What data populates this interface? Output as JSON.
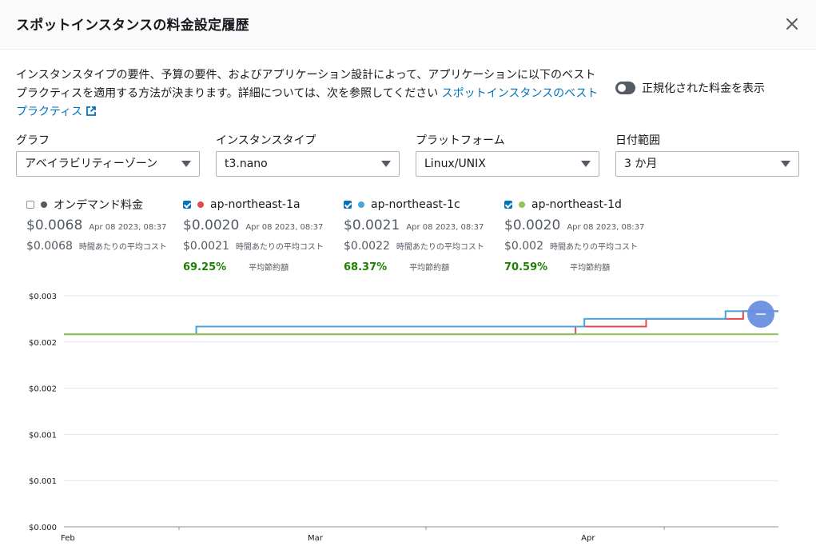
{
  "modal": {
    "title": "スポットインスタンスの料金設定履歴",
    "description": "インスタンスタイプの要件、予算の要件、およびアプリケーション設計によって、アプリケーションに以下のベストプラクティスを適用する方法が決まります。詳細については、次を参照してください",
    "link_text": "スポットインスタンスのベストプラクティス",
    "toggle_label": "正規化された料金を表示"
  },
  "filters": {
    "graph": {
      "label": "グラフ",
      "value": "アベイラビリティーゾーン"
    },
    "instance_type": {
      "label": "インスタンスタイプ",
      "value": "t3.nano"
    },
    "platform": {
      "label": "プラットフォーム",
      "value": "Linux/UNIX"
    },
    "date_range": {
      "label": "日付範囲",
      "value": "3 か月"
    }
  },
  "legend": [
    {
      "name": "オンデマンド料金",
      "checked": false,
      "color": "#545b64",
      "price": "$0.0068",
      "time": "Apr 08 2023, 08:37",
      "avg": "$0.0068",
      "avg_label": "時間あたりの平均コスト",
      "savings": "",
      "savings_label": ""
    },
    {
      "name": "ap-northeast-1a",
      "checked": true,
      "color": "#e5484d",
      "price": "$0.0020",
      "time": "Apr 08 2023, 08:37",
      "avg": "$0.0021",
      "avg_label": "時間あたりの平均コスト",
      "savings": "69.25%",
      "savings_label": "平均節約額"
    },
    {
      "name": "ap-northeast-1c",
      "checked": true,
      "color": "#4aa3df",
      "price": "$0.0021",
      "time": "Apr 08 2023, 08:37",
      "avg": "$0.0022",
      "avg_label": "時間あたりの平均コスト",
      "savings": "68.37%",
      "savings_label": "平均節約額"
    },
    {
      "name": "ap-northeast-1d",
      "checked": true,
      "color": "#8ec653",
      "price": "$0.0020",
      "time": "Apr 08 2023, 08:37",
      "avg": "$0.002",
      "avg_label": "時間あたりの平均コスト",
      "savings": "70.59%",
      "savings_label": "平均節約額"
    }
  ],
  "chart_data": {
    "type": "line",
    "y_ticks": [
      "$0.003",
      "$0.002",
      "$0.002",
      "$0.001",
      "$0.001",
      "$0.000"
    ],
    "y_tick_values": [
      0.003,
      0.0025,
      0.002,
      0.0015,
      0.001,
      0.0
    ],
    "ylim": [
      0,
      0.003
    ],
    "x_ticks": [
      "Feb",
      "Mar",
      "Apr"
    ],
    "x_tick_days": [
      0,
      28,
      59
    ],
    "x_range_days": [
      0,
      81
    ],
    "x_unit": "days since Feb 01 2023",
    "series": [
      {
        "name": "ap-northeast-1a",
        "color": "#e5484d",
        "step": true,
        "points": [
          [
            0,
            0.0025
          ],
          [
            58,
            0.0025
          ],
          [
            58,
            0.0026
          ],
          [
            66,
            0.0026
          ],
          [
            66,
            0.0027
          ],
          [
            77,
            0.0027
          ],
          [
            77,
            0.0028
          ],
          [
            81,
            0.0028
          ]
        ]
      },
      {
        "name": "ap-northeast-1c",
        "color": "#4aa3df",
        "step": true,
        "points": [
          [
            0,
            0.0025
          ],
          [
            15,
            0.0025
          ],
          [
            15,
            0.0026
          ],
          [
            59,
            0.0026
          ],
          [
            59,
            0.0027
          ],
          [
            75,
            0.0027
          ],
          [
            75,
            0.0028
          ],
          [
            81,
            0.0028
          ]
        ]
      },
      {
        "name": "ap-northeast-1d",
        "color": "#8ec653",
        "step": true,
        "points": [
          [
            0,
            0.0025
          ],
          [
            81,
            0.0025
          ]
        ]
      }
    ]
  }
}
